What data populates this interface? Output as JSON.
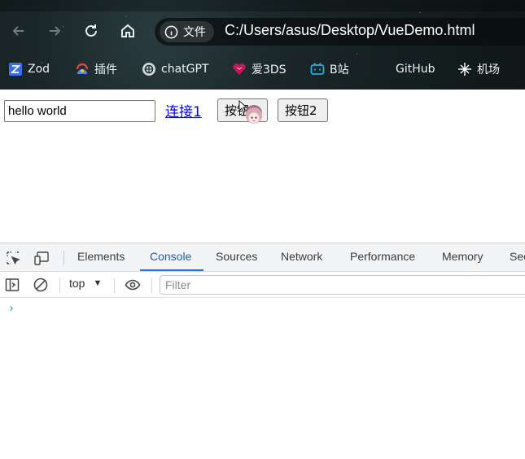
{
  "browser": {
    "chip_label": "文件",
    "url": "C:/Users/asus/Desktop/VueDemo.html",
    "bookmarks": [
      {
        "label": "Zod",
        "icon": "zod-icon",
        "color": "#3b6df0"
      },
      {
        "label": "插件",
        "icon": "extension-icon",
        "color": "#e2483d"
      },
      {
        "label": "chatGPT",
        "icon": "openai-icon",
        "color": "#cfd8d8"
      },
      {
        "label": "爱3DS",
        "icon": "heart-icon",
        "color": "#c2185b"
      },
      {
        "label": "B站",
        "icon": "bilibili-icon",
        "color": "#23ade5"
      },
      {
        "label": "GitHub",
        "icon": "github-icon",
        "color": "#ffffff"
      },
      {
        "label": "机场",
        "icon": "plane-icon",
        "color": "#ffffff"
      }
    ]
  },
  "page": {
    "input_value": "hello world",
    "link1_label": "连接1",
    "button1_label": "按钮1",
    "button2_label": "按钮2"
  },
  "devtools": {
    "tabs": [
      "Elements",
      "Console",
      "Sources",
      "Network",
      "Performance",
      "Memory",
      "Sec"
    ],
    "active_tab": "Console",
    "context": "top",
    "filter_placeholder": "Filter",
    "prompt_symbol": "›"
  }
}
